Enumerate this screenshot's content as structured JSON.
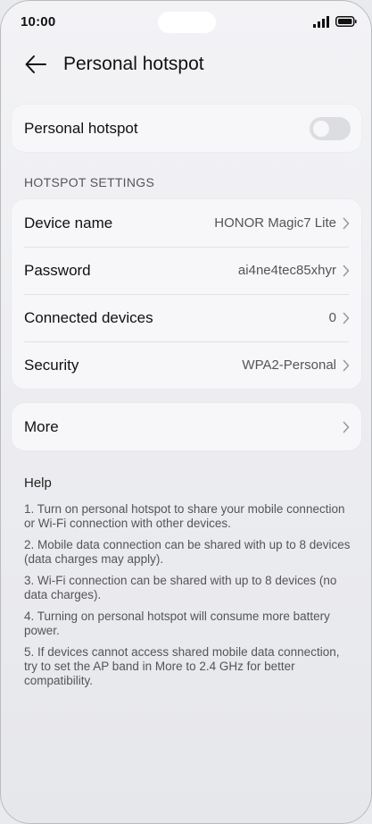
{
  "status_bar": {
    "time": "10:00"
  },
  "header": {
    "title": "Personal hotspot"
  },
  "hotspot_toggle": {
    "label": "Personal hotspot",
    "enabled": false
  },
  "settings": {
    "section_title": "HOTSPOT SETTINGS",
    "items": [
      {
        "label": "Device name",
        "value": "HONOR Magic7 Lite"
      },
      {
        "label": "Password",
        "value": "ai4ne4tec85xhyr"
      },
      {
        "label": "Connected devices",
        "value": "0"
      },
      {
        "label": "Security",
        "value": "WPA2-Personal"
      }
    ]
  },
  "more": {
    "label": "More"
  },
  "help": {
    "title": "Help",
    "items": [
      "1. Turn on personal hotspot to share your mobile connection or Wi-Fi connection with other devices.",
      "2. Mobile data connection can be shared with up to 8 devices (data charges may apply).",
      "3. Wi-Fi connection can be shared with up to 8 devices (no data charges).",
      "4. Turning on personal hotspot will consume more battery power.",
      "5. If devices cannot access shared mobile data connection, try to set the AP band in More to 2.4 GHz for better compatibility."
    ]
  },
  "colors": {
    "background": "#e9eaee",
    "card": "#f7f7f9",
    "toggle_off": "#dcdde1",
    "secondary_text": "#555555"
  }
}
